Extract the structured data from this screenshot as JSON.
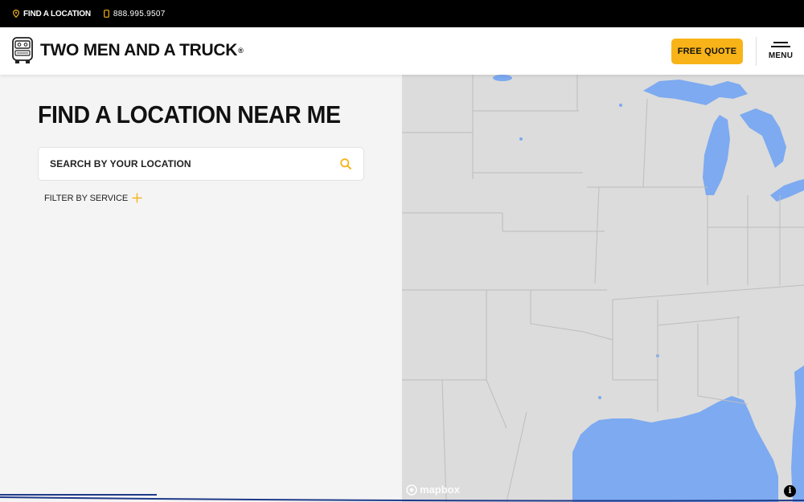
{
  "topbar": {
    "find_location": "FIND A LOCATION",
    "phone": "888.995.9507"
  },
  "header": {
    "logo_text": "TWO MEN AND A TRUCK",
    "logo_reg": "®",
    "quote_button": "FREE QUOTE",
    "menu_label": "MENU"
  },
  "main": {
    "title": "FIND A LOCATION NEAR ME",
    "search_placeholder": "SEARCH BY YOUR LOCATION",
    "filter_label": "FILTER BY SERVICE"
  },
  "map": {
    "attribution_logo": "mapbox",
    "info_icon": "i"
  },
  "colors": {
    "accent": "#f7b318",
    "water": "#7daaf0",
    "land": "#dcdcdc",
    "navy": "#1f3a8a"
  },
  "icons": [
    "location-pin-icon",
    "phone-icon",
    "search-icon",
    "plus-icon",
    "hamburger-icon",
    "mapbox-icon",
    "info-icon"
  ]
}
